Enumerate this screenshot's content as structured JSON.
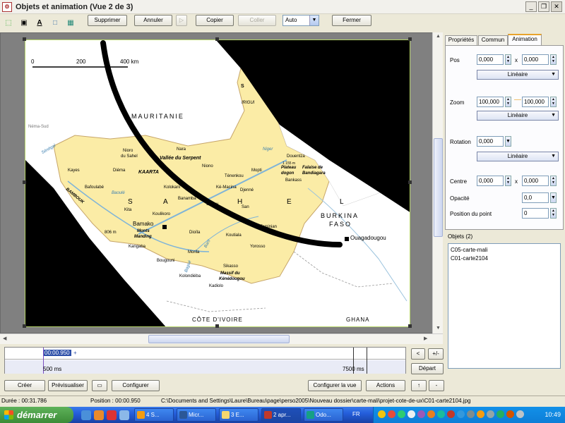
{
  "window": {
    "title": "Objets et animation  (Vue 2 de 3)",
    "app_icon": "app-icon"
  },
  "toolbar": {
    "supprimer": "Supprimer",
    "annuler": "Annuler",
    "copier": "Copier",
    "coller": "Coller",
    "mode": "Auto",
    "fermer": "Fermer"
  },
  "map": {
    "scale": {
      "zero": "0",
      "mid": "200",
      "end": "400 km"
    },
    "labels": {
      "mauritanie": "MAURITANIE",
      "sahel_s": "S",
      "sahel_a": "A",
      "sahel_h": "H",
      "sahel_e": "E",
      "sahel_l": "L",
      "burkina": "BURKINA",
      "faso": "FASO",
      "ouagadougou": "Ouagadougou",
      "cote_ivoire": "CÔTE D'IVOIRE",
      "ghana": "GHANA",
      "bamako": "Bamako",
      "monts": "Monts",
      "manding": "Manding",
      "kayes": "Kayes",
      "nioro": "Nioro",
      "du_sahel": "du Sahel",
      "nara": "Nara",
      "vallee": "Vallée du Serpent",
      "kaarta": "KAARTA",
      "mopti": "Mopti",
      "plateau": "Plateau",
      "dogon": "dogon",
      "falaise": "Falaise de",
      "bandiagara": "Bandiagara",
      "sikasso": "Sikasso",
      "massif": "Massif du",
      "kenedougou": "Kénédougou",
      "segou": "Ségou",
      "kita": "Kita",
      "bambouk": "BAMBOUK",
      "koutiala": "Koutiala",
      "bougouni": "Bougouni",
      "kangaba": "Kangaba",
      "kolondieba": "Kolondiéba",
      "kadiolo": "Kadiolo",
      "dioila": "Dioïla",
      "san": "San",
      "djenne": "Djenné",
      "tenenkou": "Ténenkou",
      "macina": "Ké-Macina",
      "diema": "Diéma",
      "bafoulabe": "Bafoulabé",
      "kolokani": "Kolokani",
      "koulikoro": "Koulikoro",
      "banamba": "Banamba",
      "douentza": "Douentza",
      "bankass": "Bankass",
      "tominian": "Tominian",
      "yorosso": "Yorosso",
      "morila": "Morila",
      "niono": "Niono",
      "nema_sud": "Néma-Sud",
      "irigui": "IRIGUI",
      "elev": "806 m",
      "hombori": "1 155 m",
      "senegal": "Sénégal",
      "bani": "Bani",
      "niger": "Niger",
      "baoule": "Baoulé",
      "bagoe": "Bagoé"
    }
  },
  "panel": {
    "tabs": [
      "Propriétés",
      "Commun",
      "Animation"
    ],
    "active_tab": "Animation",
    "pos_label": "Pos",
    "pos_x": "0,000",
    "pos_y": "0,000",
    "pos_interp": "Linéaire",
    "zoom_label": "Zoom",
    "zoom_x": "100,000",
    "zoom_y": "100,000",
    "zoom_interp": "Linéaire",
    "rotation_label": "Rotation",
    "rotation_value": "0,000",
    "rotation_interp": "Linéaire",
    "centre_label": "Centre",
    "centre_x": "0,000",
    "centre_y": "0,000",
    "opacite_label": "Opacité",
    "opacite_value": "0,0",
    "position_label": "Position du point",
    "position_value": "0",
    "x_sep": "x",
    "objects_label": "Objets (2)",
    "objects": [
      "C05-carte-mali",
      "C01-carte2104"
    ]
  },
  "timeline": {
    "cursor_time": "00:00.950",
    "plus": "+",
    "start_ms": "500 ms",
    "end_ms": "7500 ms",
    "btn_prev": "<",
    "btn_plus": "+/-",
    "btn_depart": "Départ"
  },
  "bottom": {
    "creer": "Créer",
    "previsualiser": "Prévisualiser",
    "configurer": "Configurer",
    "configurer_la_vue": "Configurer la vue",
    "actions": "Actions"
  },
  "status": {
    "duree": "Durée : 00:31.786",
    "position": "Position : 00:00.950",
    "path": "C:\\Documents and Settings\\Laure\\Bureau\\page\\perso2005\\Nouveau dossier\\carte-mali\\projet-cote-de-ux\\C01-carte2104.jpg"
  },
  "taskbar": {
    "start": "démarrer",
    "tasks": [
      "4 S...",
      "Micr...",
      "3 E...",
      "2 apr...",
      "Odo..."
    ],
    "lang": "FR",
    "clock": "10:49"
  },
  "colors": {
    "map_yellow": "#fbeca6",
    "map_yellow_dark": "#f3d88a",
    "river": "#7fb4d8",
    "taskbar_blue": "#245edb",
    "start_green": "#3c8b37",
    "tab_accent": "#e8a32c"
  }
}
